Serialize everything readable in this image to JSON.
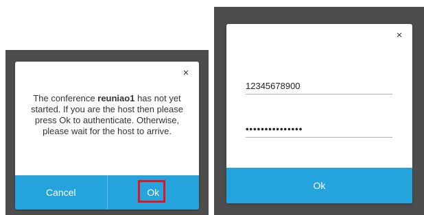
{
  "left_dialog": {
    "close_glyph": "×",
    "message_prefix": "The conference ",
    "conference_name": "reuniao1",
    "message_suffix": " has not yet started. If you are the host then please press Ok to authenticate. Otherwise, please wait for the host to arrive.",
    "cancel_label": "Cancel",
    "ok_label": "Ok",
    "highlight_color": "#e3141c"
  },
  "right_dialog": {
    "close_glyph": "×",
    "username_value": "12345678900",
    "password_value": "•••••••••••••••",
    "ok_label": "Ok"
  },
  "colors": {
    "backdrop": "#4d4d4d",
    "accent": "#24a3dc",
    "text": "#333333"
  }
}
